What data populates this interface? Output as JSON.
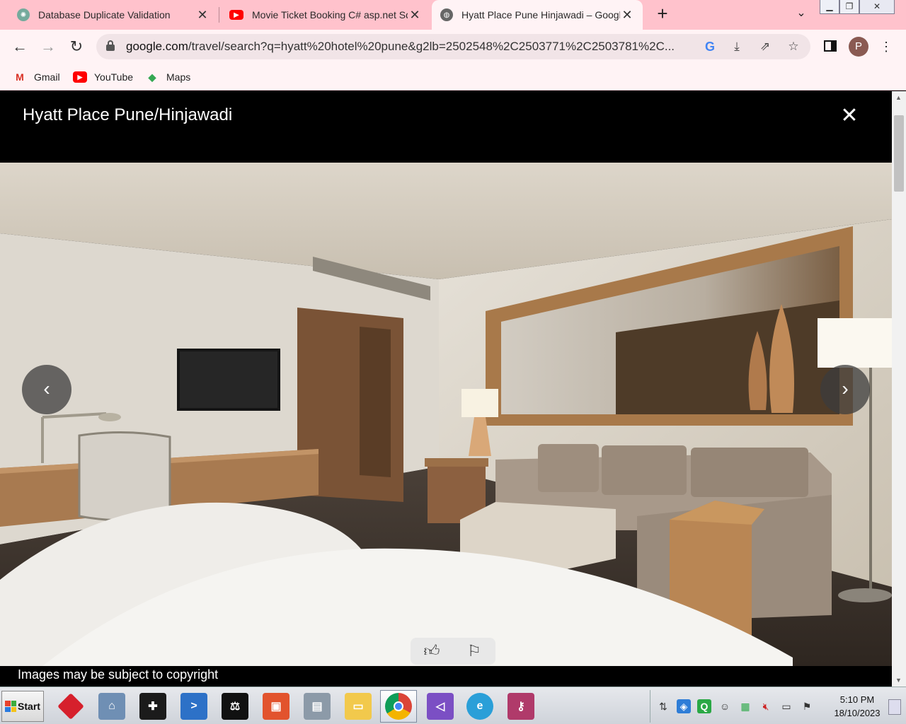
{
  "tabs": [
    {
      "title": "Database Duplicate Validation",
      "icon": "chatgpt-icon",
      "close": "✕"
    },
    {
      "title": "Movie Ticket Booking C# asp.net Sq",
      "icon": "youtube-icon",
      "close": "✕"
    },
    {
      "title": "Hyatt Place Pune Hinjawadi – Googl",
      "icon": "globe-icon",
      "close": "✕"
    }
  ],
  "new_tab": "+",
  "address": {
    "domain": "google.com",
    "path": "/travel/search?q=hyatt%20hotel%20pune&g2lb=2502548%2C2503771%2C2503781%2C..."
  },
  "profile_initial": "P",
  "bookmarks": [
    {
      "label": "Gmail",
      "icon": "gmail-icon"
    },
    {
      "label": "YouTube",
      "icon": "youtube-icon"
    },
    {
      "label": "Maps",
      "icon": "maps-icon"
    }
  ],
  "viewer": {
    "title": "Hyatt Place Pune/Hinjawadi",
    "copyright": "Images may be subject to copyright",
    "close_glyph": "✕",
    "prev_glyph": "‹",
    "next_glyph": "›"
  },
  "taskbar": {
    "start_label": "Start",
    "clock_time": "5:10 PM",
    "clock_date": "18/10/2023",
    "tray_q": "Q"
  }
}
